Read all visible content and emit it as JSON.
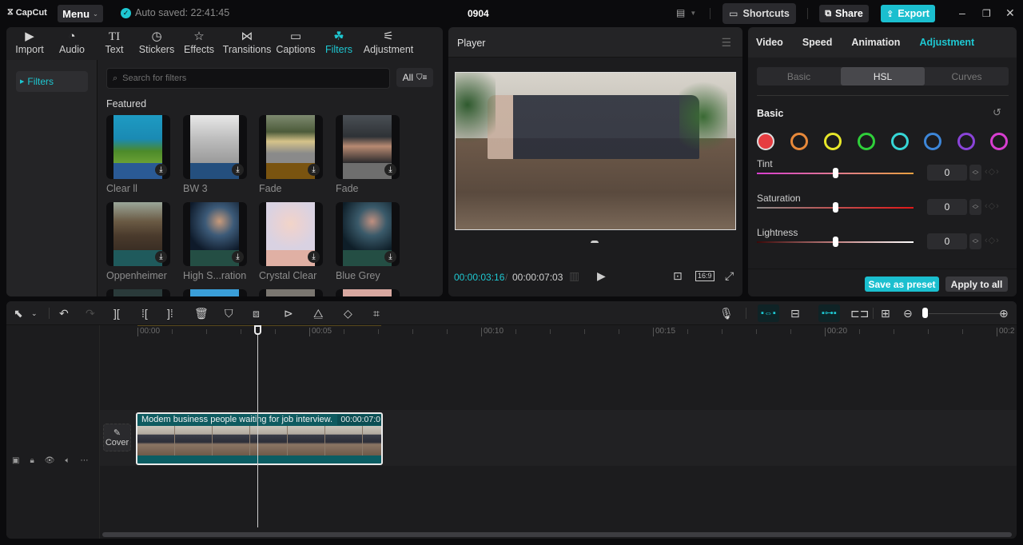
{
  "titlebar": {
    "logo": "CapCut",
    "menu_label": "Menu",
    "autosave": "Auto saved: 22:41:45",
    "project_title": "0904",
    "shortcuts_label": "Shortcuts",
    "share_label": "Share",
    "export_label": "Export"
  },
  "media": {
    "tabs": [
      {
        "label": "Import",
        "icon": "import-icon"
      },
      {
        "label": "Audio",
        "icon": "audio-icon"
      },
      {
        "label": "Text",
        "icon": "text-icon"
      },
      {
        "label": "Stickers",
        "icon": "stickers-icon"
      },
      {
        "label": "Effects",
        "icon": "effects-icon"
      },
      {
        "label": "Transitions",
        "icon": "transitions-icon"
      },
      {
        "label": "Captions",
        "icon": "captions-icon"
      },
      {
        "label": "Filters",
        "icon": "filters-icon",
        "active": true
      },
      {
        "label": "Adjustment",
        "icon": "adjustment-icon"
      }
    ],
    "sidebar_item": "Filters",
    "search_placeholder": "Search for filters",
    "filter_dropdown": "All",
    "section_title": "Featured",
    "filters": [
      {
        "name": "Clear ll",
        "band": "#2a5a95"
      },
      {
        "name": "BW 3",
        "band": "#244f7e"
      },
      {
        "name": "Fade",
        "band": "#7a5410"
      },
      {
        "name": "Fade",
        "band": "#6e6e6e"
      },
      {
        "name": "Oppenheimer",
        "band": "#1f5a5c"
      },
      {
        "name": "High S...ration",
        "band": "#244e44"
      },
      {
        "name": "Crystal Clear",
        "band": "#e0b0a4"
      },
      {
        "name": "Blue Grey",
        "band": "#244e44"
      }
    ]
  },
  "player": {
    "title": "Player",
    "current_time": "00:00:03:16",
    "separator": "/",
    "total_time": "00:00:07:03",
    "ratio_label": "16:9"
  },
  "properties": {
    "tabs": [
      "Video",
      "Speed",
      "Animation",
      "Adjustment"
    ],
    "active_tab": "Adjustment",
    "segments": [
      "Basic",
      "HSL",
      "Curves"
    ],
    "active_segment": "HSL",
    "section_title": "Basic",
    "hsl_colors": [
      "#e63c40",
      "#e8893a",
      "#e6e62a",
      "#2fcf3a",
      "#36d6d6",
      "#3d86d8",
      "#8a44d8",
      "#d83ed0"
    ],
    "selected_color": "red",
    "sliders": [
      {
        "label": "Tint",
        "value": "0",
        "level": 0.5
      },
      {
        "label": "Saturation",
        "value": "0",
        "level": 0.5
      },
      {
        "label": "Lightness",
        "value": "0",
        "level": 0.5
      }
    ],
    "save_preset_label": "Save as preset",
    "apply_all_label": "Apply to all"
  },
  "timeline": {
    "ruler_labels": [
      "00:00",
      "00:05",
      "00:10",
      "00:15",
      "00:20",
      "00:2"
    ],
    "cover_label": "Cover",
    "clip": {
      "title": "Modem business people waiting for job interview.",
      "duration": "00:00:07:0"
    }
  }
}
